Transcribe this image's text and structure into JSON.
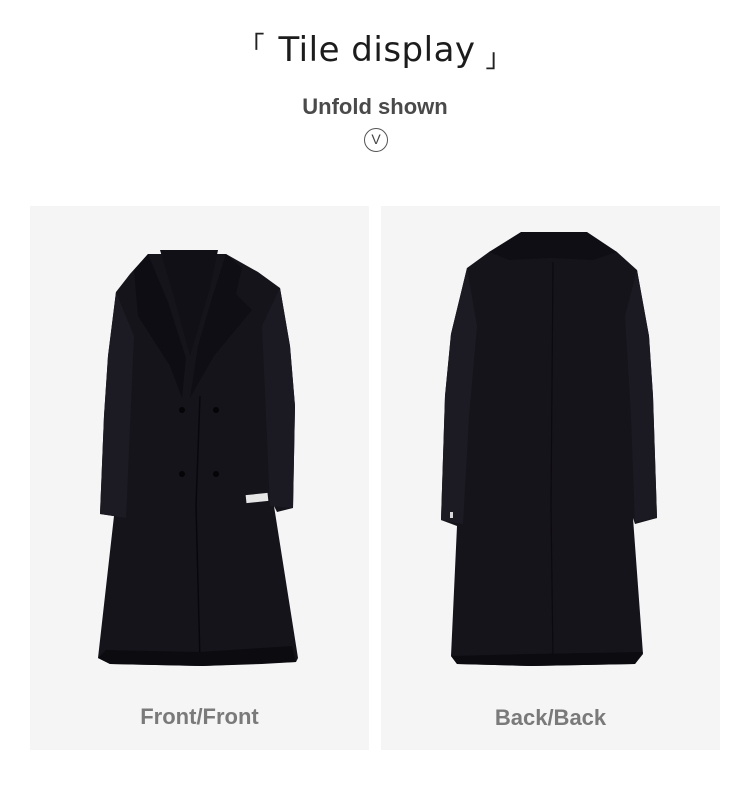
{
  "header": {
    "bracket_left": "「",
    "title": "Tile display",
    "bracket_right": "」",
    "subtitle": "Unfold shown",
    "expand_glyph": "V"
  },
  "gallery": {
    "panels": [
      {
        "caption": "Front/Front",
        "image": "coat-front"
      },
      {
        "caption": "Back/Back",
        "image": "coat-back"
      }
    ]
  },
  "colors": {
    "panel_bg": "#f5f5f5",
    "coat": "#14131a",
    "caption": "#7a7a7a",
    "title": "#1c1c1c"
  }
}
